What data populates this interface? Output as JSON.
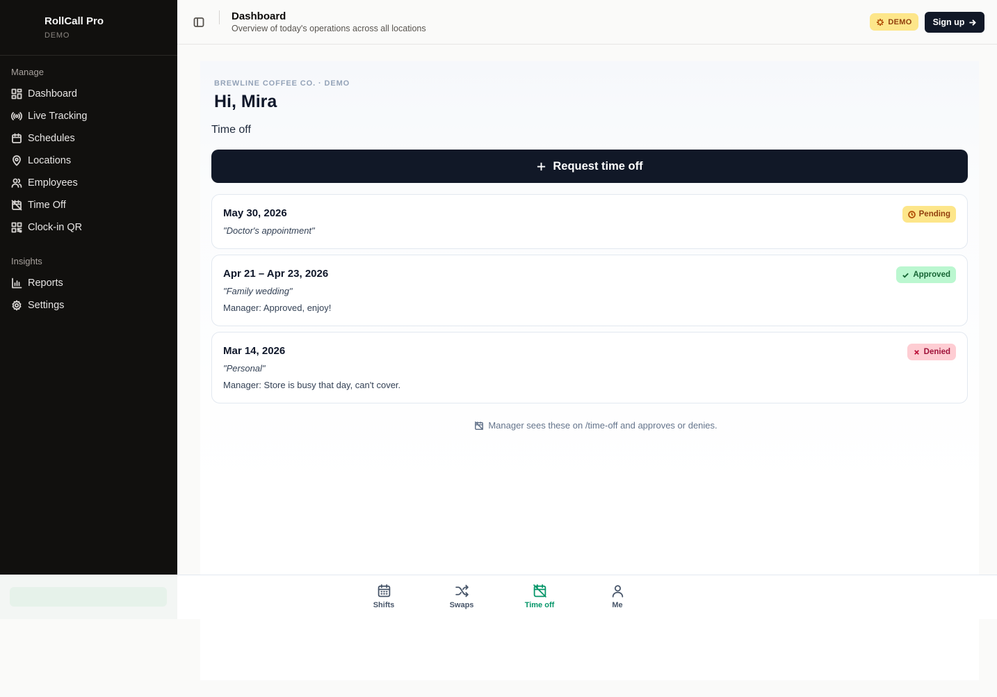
{
  "brand": {
    "name": "RollCall Pro",
    "subtitle": "DEMO"
  },
  "sidebar": {
    "sections": [
      {
        "title": "Manage",
        "items": [
          {
            "label": "Dashboard",
            "icon": "dashboard-icon"
          },
          {
            "label": "Live Tracking",
            "icon": "broadcast-icon"
          },
          {
            "label": "Schedules",
            "icon": "calendar-icon"
          },
          {
            "label": "Locations",
            "icon": "map-pin-icon"
          },
          {
            "label": "Employees",
            "icon": "users-icon"
          },
          {
            "label": "Time Off",
            "icon": "calendar-off-icon"
          },
          {
            "label": "Clock-in QR",
            "icon": "qr-code-icon"
          }
        ]
      },
      {
        "title": "Insights",
        "items": [
          {
            "label": "Reports",
            "icon": "bar-chart-icon"
          },
          {
            "label": "Settings",
            "icon": "gear-icon"
          }
        ]
      }
    ]
  },
  "header": {
    "title": "Dashboard",
    "subtitle": "Overview of today's operations across all locations",
    "demo_badge": "DEMO",
    "signup_label": "Sign up"
  },
  "main": {
    "eyebrow": "BREWLINE COFFEE CO. · DEMO",
    "greeting": "Hi, Mira",
    "section_title": "Time off",
    "request_button": "Request time off",
    "requests": [
      {
        "date": "May 30, 2026",
        "reason": "\"Doctor's appointment\"",
        "status": "Pending",
        "manager_note": ""
      },
      {
        "date": "Apr 21 – Apr 23, 2026",
        "reason": "\"Family wedding\"",
        "status": "Approved",
        "manager_note": "Manager: Approved, enjoy!"
      },
      {
        "date": "Mar 14, 2026",
        "reason": "\"Personal\"",
        "status": "Denied",
        "manager_note": "Manager: Store is busy that day, can't cover."
      }
    ],
    "footer_note": "Manager sees these on /time-off and approves or denies."
  },
  "tabbar": {
    "tabs": [
      {
        "label": "Shifts",
        "icon": "calendar-icon"
      },
      {
        "label": "Swaps",
        "icon": "shuffle-icon"
      },
      {
        "label": "Time off",
        "icon": "calendar-off-icon",
        "active": true
      },
      {
        "label": "Me",
        "icon": "user-icon"
      }
    ]
  },
  "colors": {
    "accent": "#059669",
    "sidebar_bg": "#11100e",
    "primary_button": "#111827",
    "pending": "#fde68a",
    "approved": "#bbf7d0",
    "denied": "#fecdd3"
  }
}
